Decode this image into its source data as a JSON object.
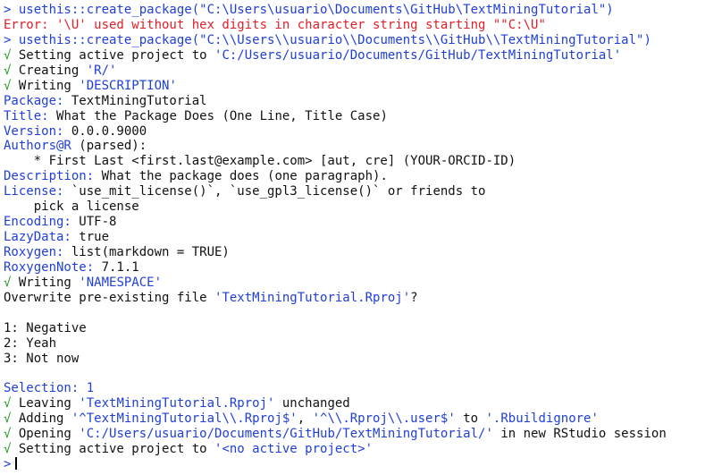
{
  "console": {
    "lines": [
      {
        "segments": [
          {
            "text": "> ",
            "c": "blue"
          },
          {
            "text": "usethis::create_package(\"C:\\Users\\usuario\\Documents\\GitHub\\TextMiningTutorial\")",
            "c": "blue"
          }
        ]
      },
      {
        "segments": [
          {
            "text": "Error: '\\U' used without hex digits in character string starting \"\"C:\\U\"",
            "c": "red"
          }
        ]
      },
      {
        "segments": [
          {
            "text": "> ",
            "c": "blue"
          },
          {
            "text": "usethis::create_package(\"C:\\\\Users\\\\usuario\\\\Documents\\\\GitHub\\\\TextMiningTutorial\")",
            "c": "blue"
          }
        ]
      },
      {
        "segments": [
          {
            "text": "√ ",
            "c": "green"
          },
          {
            "text": "Setting active project to ",
            "c": "black"
          },
          {
            "text": "'C:/Users/usuario/Documents/GitHub/TextMiningTutorial'",
            "c": "blue"
          }
        ]
      },
      {
        "segments": [
          {
            "text": "√ ",
            "c": "green"
          },
          {
            "text": "Creating ",
            "c": "black"
          },
          {
            "text": "'R/'",
            "c": "blue"
          }
        ]
      },
      {
        "segments": [
          {
            "text": "√ ",
            "c": "green"
          },
          {
            "text": "Writing ",
            "c": "black"
          },
          {
            "text": "'DESCRIPTION'",
            "c": "blue"
          }
        ]
      },
      {
        "segments": [
          {
            "text": "Package: ",
            "c": "blue"
          },
          {
            "text": "TextMiningTutorial",
            "c": "black"
          }
        ]
      },
      {
        "segments": [
          {
            "text": "Title: ",
            "c": "blue"
          },
          {
            "text": "What the Package Does (One Line, Title Case)",
            "c": "black"
          }
        ]
      },
      {
        "segments": [
          {
            "text": "Version: ",
            "c": "blue"
          },
          {
            "text": "0.0.0.9000",
            "c": "black"
          }
        ]
      },
      {
        "segments": [
          {
            "text": "Authors@R ",
            "c": "blue"
          },
          {
            "text": "(parsed):",
            "c": "black"
          }
        ]
      },
      {
        "segments": [
          {
            "text": "    * First Last <first.last@example.com> [aut, cre] (YOUR-ORCID-ID)",
            "c": "black"
          }
        ]
      },
      {
        "segments": [
          {
            "text": "Description: ",
            "c": "blue"
          },
          {
            "text": "What the package does (one paragraph).",
            "c": "black"
          }
        ]
      },
      {
        "segments": [
          {
            "text": "License: ",
            "c": "blue"
          },
          {
            "text": "`use_mit_license()`, `use_gpl3_license()` or friends to",
            "c": "black"
          }
        ]
      },
      {
        "segments": [
          {
            "text": "    pick a license",
            "c": "black"
          }
        ]
      },
      {
        "segments": [
          {
            "text": "Encoding: ",
            "c": "blue"
          },
          {
            "text": "UTF-8",
            "c": "black"
          }
        ]
      },
      {
        "segments": [
          {
            "text": "LazyData: ",
            "c": "blue"
          },
          {
            "text": "true",
            "c": "black"
          }
        ]
      },
      {
        "segments": [
          {
            "text": "Roxygen: ",
            "c": "blue"
          },
          {
            "text": "list(markdown = TRUE)",
            "c": "black"
          }
        ]
      },
      {
        "segments": [
          {
            "text": "RoxygenNote: ",
            "c": "blue"
          },
          {
            "text": "7.1.1",
            "c": "black"
          }
        ]
      },
      {
        "segments": [
          {
            "text": "√ ",
            "c": "green"
          },
          {
            "text": "Writing ",
            "c": "black"
          },
          {
            "text": "'NAMESPACE'",
            "c": "blue"
          }
        ]
      },
      {
        "segments": [
          {
            "text": "Overwrite pre-existing file ",
            "c": "black"
          },
          {
            "text": "'TextMiningTutorial.Rproj'",
            "c": "blue"
          },
          {
            "text": "?",
            "c": "black"
          }
        ]
      },
      {
        "segments": [
          {
            "text": "",
            "c": "black"
          }
        ]
      },
      {
        "segments": [
          {
            "text": "1: Negative",
            "c": "black"
          }
        ]
      },
      {
        "segments": [
          {
            "text": "2: Yeah",
            "c": "black"
          }
        ]
      },
      {
        "segments": [
          {
            "text": "3: Not now",
            "c": "black"
          }
        ]
      },
      {
        "segments": [
          {
            "text": "",
            "c": "black"
          }
        ]
      },
      {
        "segments": [
          {
            "text": "Selection: 1",
            "c": "blue"
          }
        ]
      },
      {
        "segments": [
          {
            "text": "√ ",
            "c": "green"
          },
          {
            "text": "Leaving ",
            "c": "black"
          },
          {
            "text": "'TextMiningTutorial.Rproj'",
            "c": "blue"
          },
          {
            "text": " unchanged",
            "c": "black"
          }
        ]
      },
      {
        "segments": [
          {
            "text": "√ ",
            "c": "green"
          },
          {
            "text": "Adding ",
            "c": "black"
          },
          {
            "text": "'^TextMiningTutorial\\\\.Rproj$'",
            "c": "blue"
          },
          {
            "text": ", ",
            "c": "black"
          },
          {
            "text": "'^\\\\.Rproj\\\\.user$'",
            "c": "blue"
          },
          {
            "text": " to ",
            "c": "black"
          },
          {
            "text": "'.Rbuildignore'",
            "c": "blue"
          }
        ]
      },
      {
        "segments": [
          {
            "text": "√ ",
            "c": "green"
          },
          {
            "text": "Opening ",
            "c": "black"
          },
          {
            "text": "'C:/Users/usuario/Documents/GitHub/TextMiningTutorial/'",
            "c": "blue"
          },
          {
            "text": " in new RStudio session",
            "c": "black"
          }
        ]
      },
      {
        "segments": [
          {
            "text": "√ ",
            "c": "green"
          },
          {
            "text": "Setting active project to ",
            "c": "black"
          },
          {
            "text": "'<no active project>'",
            "c": "blue"
          }
        ]
      }
    ],
    "prompt": ">"
  },
  "colors": {
    "blue": "#1f3fd8",
    "red": "#e0202a",
    "green": "#1f9b1f",
    "black": "#111111"
  }
}
